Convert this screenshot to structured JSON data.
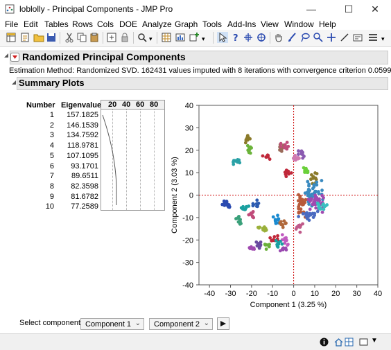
{
  "window": {
    "title": "loblolly - Principal Components - JMP Pro"
  },
  "menu": [
    "File",
    "Edit",
    "Tables",
    "Rows",
    "Cols",
    "DOE",
    "Analyze",
    "Graph",
    "Tools",
    "Add-Ins",
    "View",
    "Window",
    "Help"
  ],
  "report": {
    "title": "Randomized Principal Components",
    "estimation": "Estimation Method: Randomized SVD.  162431 values imputed with 8 iterations with convergence criterion 0.0599",
    "summary_title": "Summary Plots"
  },
  "eigen_table": {
    "headers": [
      "Number",
      "Eigenvalue"
    ],
    "bar_ticks": [
      "20",
      "40",
      "60",
      "80"
    ],
    "rows": [
      {
        "number": "1",
        "eigenvalue": "157.1825"
      },
      {
        "number": "2",
        "eigenvalue": "146.1539"
      },
      {
        "number": "3",
        "eigenvalue": "134.7592"
      },
      {
        "number": "4",
        "eigenvalue": "118.9781"
      },
      {
        "number": "5",
        "eigenvalue": "107.1095"
      },
      {
        "number": "6",
        "eigenvalue": "93.1701"
      },
      {
        "number": "7",
        "eigenvalue": "89.6511"
      },
      {
        "number": "8",
        "eigenvalue": "82.3598"
      },
      {
        "number": "9",
        "eigenvalue": "81.6782"
      },
      {
        "number": "10",
        "eigenvalue": "77.2589"
      }
    ]
  },
  "chart_data": {
    "type": "scatter",
    "title": "",
    "xlabel": "Component 1  (3.25 %)",
    "ylabel": "Component 2  (3.03 %)",
    "xlim": [
      -45,
      40
    ],
    "ylim": [
      -40,
      40
    ],
    "xticks": [
      "-40",
      "-30",
      "-20",
      "-10",
      "0",
      "10",
      "20",
      "30",
      "40"
    ],
    "yticks": [
      "40",
      "30",
      "20",
      "10",
      "0",
      "-10",
      "-20",
      "-30",
      "-40"
    ],
    "reference_lines": {
      "x": 0,
      "y": 0,
      "color": "#cc0000"
    },
    "clusters": [
      {
        "cx": -22,
        "cy": 25,
        "sx": 1.5,
        "sy": 1.5,
        "n": 12,
        "color": "#8b7a2a"
      },
      {
        "cx": -21,
        "cy": 20,
        "sx": 1.5,
        "sy": 1.5,
        "n": 12,
        "color": "#6bb33a"
      },
      {
        "cx": -27,
        "cy": 15,
        "sx": 2.5,
        "sy": 1.2,
        "n": 12,
        "color": "#2aa1a6"
      },
      {
        "cx": -13,
        "cy": 17,
        "sx": 1.5,
        "sy": 0.8,
        "n": 8,
        "color": "#c0283a"
      },
      {
        "cx": -6,
        "cy": 21,
        "sx": 1.2,
        "sy": 1.2,
        "n": 10,
        "color": "#9a6b5a"
      },
      {
        "cx": -4,
        "cy": 22,
        "sx": 1.5,
        "sy": 1.2,
        "n": 10,
        "color": "#c04b7a"
      },
      {
        "cx": -3,
        "cy": 10,
        "sx": 1.2,
        "sy": 1.5,
        "n": 10,
        "color": "#c0283a"
      },
      {
        "cx": 1,
        "cy": 17,
        "sx": 1.5,
        "sy": 1.5,
        "n": 10,
        "color": "#d07ab0"
      },
      {
        "cx": 4,
        "cy": 18,
        "sx": 1.5,
        "sy": 1.5,
        "n": 10,
        "color": "#8a5ab0"
      },
      {
        "cx": 6,
        "cy": 10,
        "sx": 1.5,
        "sy": 1.5,
        "n": 12,
        "color": "#6ad03a"
      },
      {
        "cx": 9,
        "cy": 8,
        "sx": 1.5,
        "sy": 2,
        "n": 12,
        "color": "#8b7a2a"
      },
      {
        "cx": 9,
        "cy": 2,
        "sx": 3.5,
        "sy": 4,
        "n": 40,
        "color": "#3a8ac0"
      },
      {
        "cx": 11,
        "cy": -3,
        "sx": 3,
        "sy": 3,
        "n": 35,
        "color": "#a04ab0"
      },
      {
        "cx": 4,
        "cy": -4,
        "sx": 2.5,
        "sy": 4,
        "n": 25,
        "color": "#b85a3a"
      },
      {
        "cx": 13,
        "cy": -5,
        "sx": 2,
        "sy": 2,
        "n": 15,
        "color": "#3ac0c0"
      },
      {
        "cx": 7,
        "cy": -9,
        "sx": 3,
        "sy": 2,
        "n": 18,
        "color": "#4a6ac0"
      },
      {
        "cx": 3,
        "cy": -14,
        "sx": 1.5,
        "sy": 2,
        "n": 10,
        "color": "#c05a8a"
      },
      {
        "cx": -32,
        "cy": -4,
        "sx": 1.5,
        "sy": 1.5,
        "n": 14,
        "color": "#2a4ab0"
      },
      {
        "cx": -23,
        "cy": -6,
        "sx": 1.5,
        "sy": 1.5,
        "n": 10,
        "color": "#1aa0a0"
      },
      {
        "cx": -26,
        "cy": -11,
        "sx": 1.5,
        "sy": 1.5,
        "n": 10,
        "color": "#3aa07a"
      },
      {
        "cx": -18,
        "cy": -4,
        "sx": 1.2,
        "sy": 1.5,
        "n": 10,
        "color": "#2a5ab0"
      },
      {
        "cx": -20,
        "cy": -9,
        "sx": 1.2,
        "sy": 1.2,
        "n": 8,
        "color": "#c04b7a"
      },
      {
        "cx": -14,
        "cy": -15,
        "sx": 2,
        "sy": 1,
        "n": 12,
        "color": "#9ab03a"
      },
      {
        "cx": -8,
        "cy": -11,
        "sx": 1.5,
        "sy": 1.5,
        "n": 10,
        "color": "#1a8ad0"
      },
      {
        "cx": -5,
        "cy": -13,
        "sx": 1.5,
        "sy": 1.5,
        "n": 10,
        "color": "#b0683a"
      },
      {
        "cx": -9,
        "cy": -20,
        "sx": 1.5,
        "sy": 1.5,
        "n": 10,
        "color": "#c0283a"
      },
      {
        "cx": -4,
        "cy": -20,
        "sx": 1.5,
        "sy": 1.5,
        "n": 10,
        "color": "#c05ac0"
      },
      {
        "cx": -5,
        "cy": -24,
        "sx": 1.5,
        "sy": 1.5,
        "n": 10,
        "color": "#9a4ab0"
      },
      {
        "cx": -7,
        "cy": -22,
        "sx": 1.5,
        "sy": 1.5,
        "n": 8,
        "color": "#1aa0a0"
      },
      {
        "cx": -17,
        "cy": -22,
        "sx": 1.5,
        "sy": 1.5,
        "n": 10,
        "color": "#6a4aa0"
      },
      {
        "cx": -20,
        "cy": -24,
        "sx": 1.2,
        "sy": 1.2,
        "n": 8,
        "color": "#a04ab0"
      },
      {
        "cx": -13,
        "cy": -23,
        "sx": 1.2,
        "sy": 1.2,
        "n": 8,
        "color": "#6ab03a"
      }
    ]
  },
  "component_select": {
    "label": "Select component",
    "first": "Component 1",
    "second": "Component 2"
  }
}
